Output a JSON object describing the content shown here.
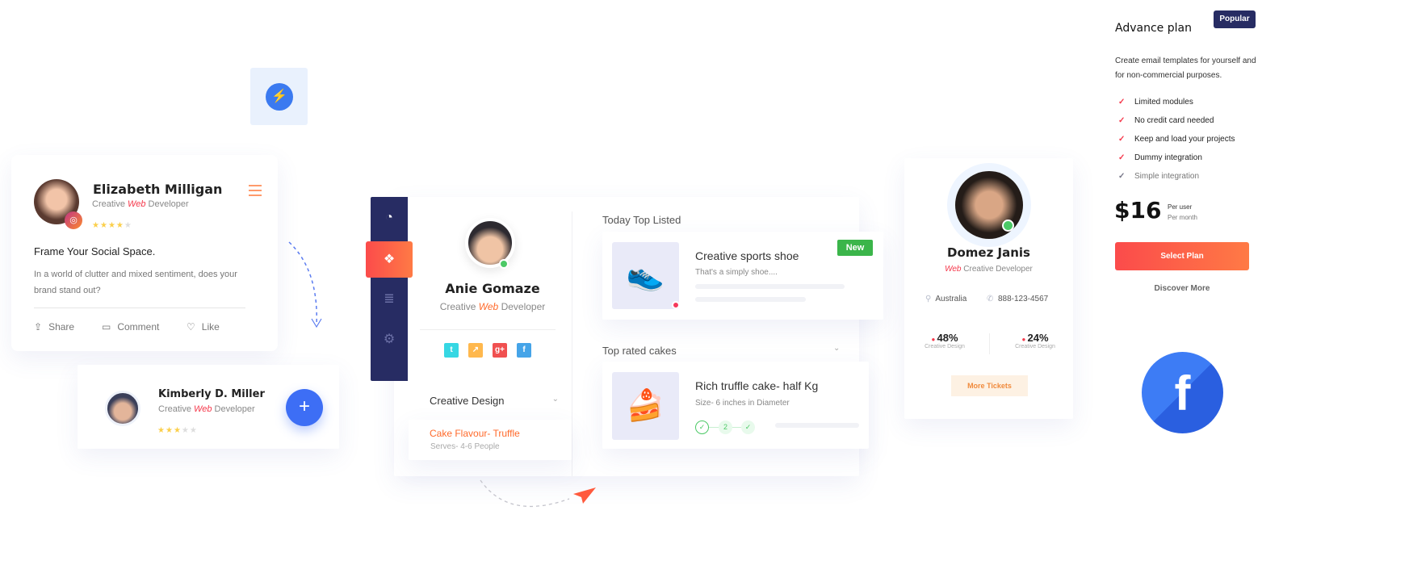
{
  "messenger": {
    "icon": "messenger-icon"
  },
  "social_card": {
    "name": "Elizabeth Milligan",
    "role_pre": "Creative",
    "role_accent": "Web",
    "role_post": "Developer",
    "rating": 4,
    "max_rating": 5,
    "headline": "Frame Your Social Space.",
    "body": "In a world of clutter and mixed sentiment, does your brand stand out?",
    "actions": {
      "share": "Share",
      "comment": "Comment",
      "like": "Like"
    }
  },
  "contact_card": {
    "name": "Kimberly D. Miller",
    "role_pre": "Creative",
    "role_accent": "Web",
    "role_post": "Developer",
    "rating": 3,
    "max_rating": 5
  },
  "dashboard": {
    "profile": {
      "name": "Anie Gomaze",
      "role_pre": "Creative",
      "role_accent": "Web",
      "role_post": "Developer"
    },
    "menu": {
      "label": "Creative Design",
      "item_title": "Cake Flavour- Truffle",
      "item_sub": "Serves- 4-6 People"
    },
    "section1": {
      "title": "Today Top Listed",
      "product": {
        "title": "Creative sports shoe",
        "sub": "That's a simply shoe....",
        "badge": "New"
      }
    },
    "section2": {
      "title": "Top rated cakes",
      "product": {
        "title": "Rich truffle cake- half Kg",
        "sub": "Size- 6 inches in Diameter",
        "step": "2"
      }
    }
  },
  "profile_card": {
    "name": "Domez Janis",
    "role_accent": "Web",
    "role_post": "Creative Developer",
    "location": "Australia",
    "phone": "888-123-4567",
    "stats": [
      {
        "value": "48%",
        "label": "Creative Design"
      },
      {
        "value": "24%",
        "label": "Creative Design"
      }
    ],
    "button": "More Tickets"
  },
  "pricing": {
    "title": "Advance plan",
    "badge": "Popular",
    "desc1": "Create email templates for yourself and",
    "desc2": "for non-commercial purposes.",
    "features": [
      "Limited modules",
      "No credit card needed",
      "Keep and load your projects",
      "Dummy  integration",
      "Simple integration"
    ],
    "price": "$16",
    "per1": "Per user",
    "per2": "Per month",
    "cta": "Select Plan",
    "link": "Discover More"
  },
  "colors": {
    "navy": "#272c63",
    "accent": "#f5384b",
    "orange": "#ff7043",
    "blue": "#3d6ef5",
    "green": "#3bb54a"
  }
}
